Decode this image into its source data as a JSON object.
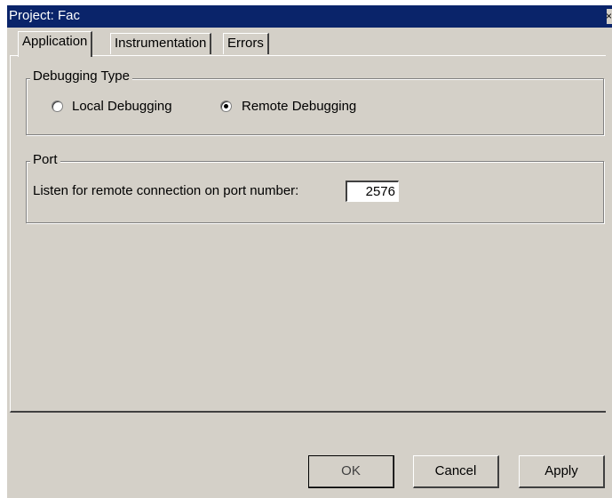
{
  "window": {
    "title": "Project: Fac",
    "close_glyph": "×"
  },
  "tabs": [
    {
      "label": "Application",
      "active": true
    },
    {
      "label": "Instrumentation",
      "active": false
    },
    {
      "label": "Errors",
      "active": false
    }
  ],
  "debugging_type": {
    "group_label": "Debugging Type",
    "options": [
      {
        "label": "Local Debugging",
        "selected": false
      },
      {
        "label": "Remote Debugging",
        "selected": true
      }
    ]
  },
  "port": {
    "group_label": "Port",
    "field_label": "Listen for remote connection on port number:",
    "value": "2576"
  },
  "buttons": {
    "ok": "OK",
    "cancel": "Cancel",
    "apply": "Apply"
  }
}
